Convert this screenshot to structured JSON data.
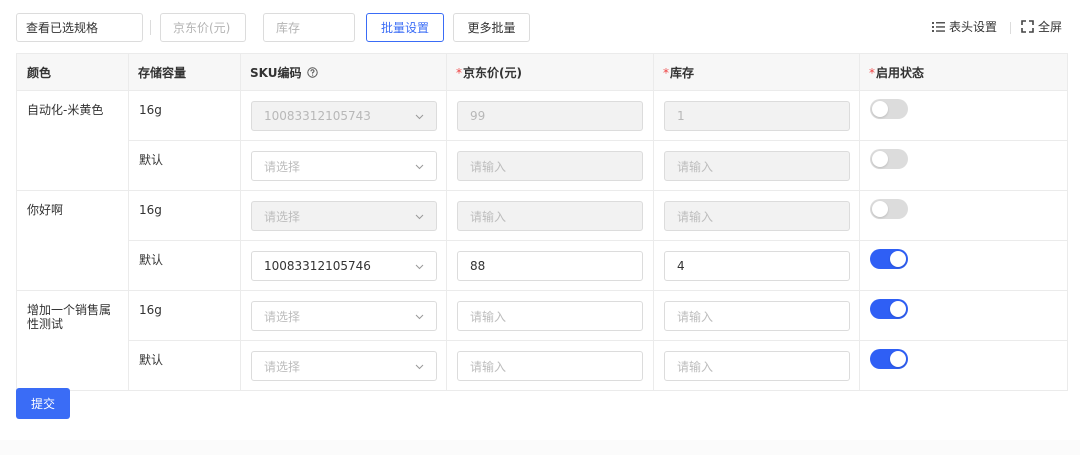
{
  "toolbar": {
    "view_selected_label": "查看已选规格",
    "price_placeholder": "京东价(元)",
    "stock_placeholder": "库存",
    "batch_set_label": "批量设置",
    "more_batch_label": "更多批量",
    "header_settings_label": "表头设置",
    "fullscreen_label": "全屏"
  },
  "table": {
    "headers": {
      "color": "颜色",
      "storage": "存储容量",
      "sku": "SKU编码",
      "price": "京东价(元)",
      "stock": "库存",
      "status": "启用状态"
    },
    "required_mark": "*",
    "groups": [
      {
        "color": "自动化-米黄色",
        "rows": [
          {
            "storage": "16g",
            "sku": "10083312105743",
            "sku_disabled": true,
            "sku_placeholder": false,
            "price": "99",
            "price_disabled": true,
            "price_placeholder": false,
            "stock": "1",
            "stock_disabled": true,
            "stock_placeholder": false,
            "enabled": false
          },
          {
            "storage": "默认",
            "sku": "请选择",
            "sku_disabled": false,
            "sku_placeholder": true,
            "price": "请输入",
            "price_disabled": true,
            "price_placeholder": true,
            "stock": "请输入",
            "stock_disabled": true,
            "stock_placeholder": true,
            "enabled": false
          }
        ]
      },
      {
        "color": "你好啊",
        "rows": [
          {
            "storage": "16g",
            "sku": "请选择",
            "sku_disabled": true,
            "sku_placeholder": true,
            "price": "请输入",
            "price_disabled": true,
            "price_placeholder": true,
            "stock": "请输入",
            "stock_disabled": true,
            "stock_placeholder": true,
            "enabled": false
          },
          {
            "storage": "默认",
            "sku": "10083312105746",
            "sku_disabled": false,
            "sku_placeholder": false,
            "price": "88",
            "price_disabled": false,
            "price_placeholder": false,
            "stock": "4",
            "stock_disabled": false,
            "stock_placeholder": false,
            "enabled": true
          }
        ]
      },
      {
        "color": "增加一个销售属性测试",
        "rows": [
          {
            "storage": "16g",
            "sku": "请选择",
            "sku_disabled": false,
            "sku_placeholder": true,
            "price": "请输入",
            "price_disabled": false,
            "price_placeholder": true,
            "stock": "请输入",
            "stock_disabled": false,
            "stock_placeholder": true,
            "enabled": true
          },
          {
            "storage": "默认",
            "sku": "请选择",
            "sku_disabled": false,
            "sku_placeholder": true,
            "price": "请输入",
            "price_disabled": false,
            "price_placeholder": true,
            "stock": "请输入",
            "stock_disabled": false,
            "stock_placeholder": true,
            "enabled": true
          }
        ]
      }
    ]
  },
  "submit_label": "提交",
  "colors": {
    "accent": "#3a6cf6",
    "switch_on": "#2f5ff5",
    "switch_off": "#dcdcdc",
    "required": "#ee4444"
  }
}
